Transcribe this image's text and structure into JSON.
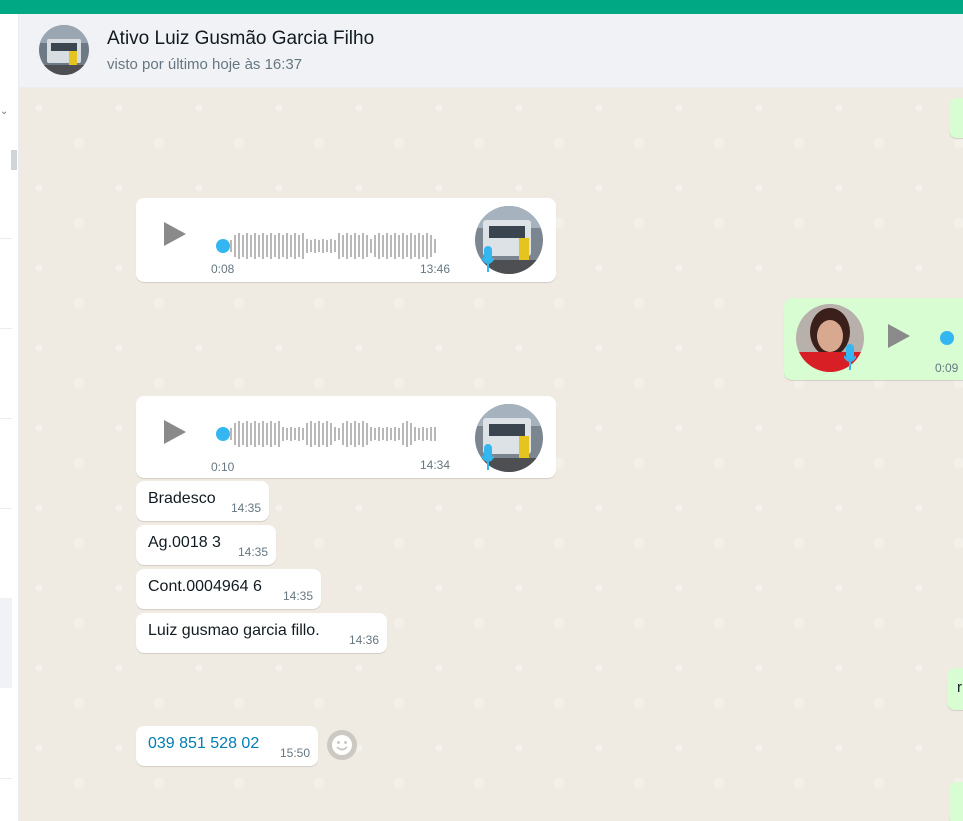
{
  "header": {
    "contact_name": "Ativo Luiz Gusmão Garcia Filho",
    "last_seen": "visto por último hoje às 16:37"
  },
  "messages": [
    {
      "type": "voice",
      "direction": "in",
      "duration": "0:08",
      "time": "13:46"
    },
    {
      "type": "voice",
      "direction": "out",
      "duration": "0:09"
    },
    {
      "type": "voice",
      "direction": "in",
      "duration": "0:10",
      "time": "14:34"
    },
    {
      "type": "text",
      "direction": "in",
      "text": "Bradesco",
      "time": "14:35"
    },
    {
      "type": "text",
      "direction": "in",
      "text": "Ag.0018 3",
      "time": "14:35"
    },
    {
      "type": "text",
      "direction": "in",
      "text": "Cont.0004964 6",
      "time": "14:35"
    },
    {
      "type": "text",
      "direction": "in",
      "text": "Luiz gusmao garcia fillo.",
      "time": "14:36"
    },
    {
      "type": "text",
      "direction": "in",
      "text": "039 851 528 02",
      "time": "15:50",
      "is_link": true
    }
  ],
  "partial_out_text": "r",
  "colors": {
    "accent": "#00a884",
    "incoming_bubble": "#ffffff",
    "outgoing_bubble": "#d9fdd3",
    "link": "#027eb5",
    "audio_dot": "#34b7f1"
  },
  "icons": [
    "play-icon",
    "mic-icon",
    "emoji-reaction-icon",
    "chevron-down-icon"
  ]
}
